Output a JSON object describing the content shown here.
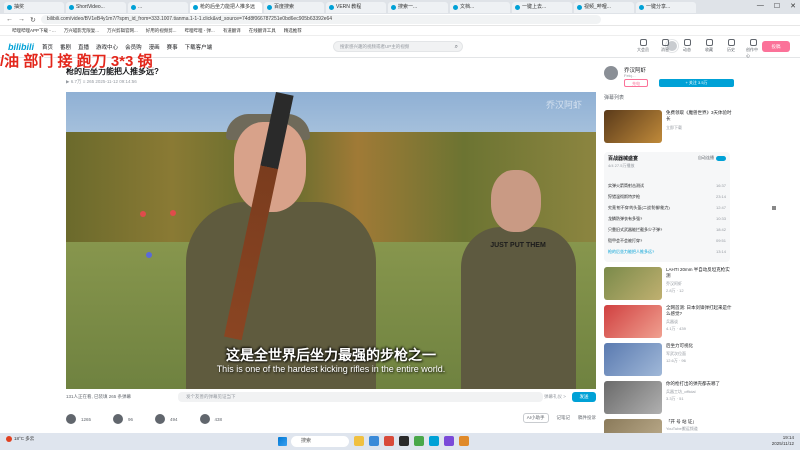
{
  "browser": {
    "tabs": [
      {
        "label": "抽奖",
        "active": false
      },
      {
        "label": "ShortVideo...",
        "active": false
      },
      {
        "label": "...",
        "active": false
      },
      {
        "label": "枪的后坐力能把人推多远",
        "active": true
      },
      {
        "label": "百度搜索",
        "active": false
      },
      {
        "label": "VERN 教程",
        "active": false
      },
      {
        "label": "搜索一...",
        "active": false
      },
      {
        "label": "文档...",
        "active": false
      },
      {
        "label": "一键上去...",
        "active": false
      },
      {
        "label": "视频_哔哩...",
        "active": false
      },
      {
        "label": "一键分享...",
        "active": false
      }
    ],
    "url": "bilibili.com/video/BV1eB4y1m7/?spm_id_from=333.1007.tianma.1-1-1.click&vd_source=74d8f066787251e0bd6ec905b63392e64",
    "bookmarks": [
      "哔哩哔哩APP下载 - ...",
      "万兴喵影无限复...",
      "万兴剪辑官网...",
      "好用的视频剪...",
      "哔哩哔哩 - 弹...",
      "有道翻译",
      "在线翻译工具",
      "精选推荐"
    ]
  },
  "site_header": {
    "logo": "bilibili",
    "nav": [
      "首页",
      "番剧",
      "直播",
      "游戏中心",
      "会员购",
      "漫画",
      "赛事",
      "下载客户端"
    ],
    "search_placeholder": "搜索感兴趣的视频或者UP主的视频",
    "right_icons": [
      {
        "label": "大会员",
        "icon": "vip-icon"
      },
      {
        "label": "消息",
        "icon": "message-icon"
      },
      {
        "label": "动态",
        "icon": "dynamic-icon"
      },
      {
        "label": "收藏",
        "icon": "favorite-icon"
      },
      {
        "label": "历史",
        "icon": "history-icon"
      },
      {
        "label": "创作中心",
        "icon": "creator-icon"
      }
    ],
    "upload_label": "投稿"
  },
  "overlay_text": "/油 部门 接 跑刀 3*3 锅",
  "video": {
    "title": "枪的后坐力能把人推多远?",
    "meta": "▶ 6.7万  ≡ 265  2025-11-12 09:14:56",
    "watermark": "乔汉阿虾",
    "shirt_text": "JUST PUT THEM",
    "subtitle_zh": "这是全世界后坐力最强的步枪之一",
    "subtitle_en": "This is one of the hardest kicking rifles in the entire world."
  },
  "danmu": {
    "count": "131人正在看, 已装填 265 条弹幕",
    "placeholder": "发个友善的弹幕见证当下",
    "etiquette": "弹幕礼仪 >",
    "send_label": "发送"
  },
  "actions": {
    "like": "1265",
    "coin": "96",
    "favorite": "494",
    "share": "438",
    "notes": "AI小助手",
    "more": "记笔记",
    "report": "稿件投诉"
  },
  "uploader": {
    "name": "乔汉阿虾",
    "badge": "发消息",
    "desc": "Feiq…",
    "charge_label": "充电",
    "follow_label": "+ 关注 3.5万"
  },
  "sidebar": {
    "tab_label": "弹幕列表",
    "top_rec": {
      "title": "免费领取《魔兽世界》3天体验时长",
      "meta": "立即下载"
    },
    "list": {
      "title": "百战器械盛宴",
      "sub": "4/4 27.5万播放",
      "auto_label": "自动连播",
      "items": [
        {
          "title": "实弹火箭筒射击测试",
          "dur": "16:37"
        },
        {
          "title": "狩猎温彻斯特步枪",
          "dur": "23:14"
        },
        {
          "title": "究竟'射不穿'的头盔(二战'防御'能力)",
          "dur": "12:47"
        },
        {
          "title": "龙鳞防弹衣有多强?",
          "dur": "10:33"
        },
        {
          "title": "只靠旧式武器能拦截多少子弹?",
          "dur": "18:42"
        },
        {
          "title": "铠甲会不会被打穿?",
          "dur": "09:51"
        },
        {
          "title": "枪的后坐力能把人推多远?",
          "dur": "13:14"
        }
      ]
    },
    "recs": [
      {
        "title": "LAHTI 20mm 半自动反坦克枪实测",
        "up": "乔汉阿虾",
        "stats": "2.8万 · 12"
      },
      {
        "title": "全网首测: 日本剑锋弹打起来是什么感觉?",
        "up": "兵器谈",
        "stats": "4.1万 · 439"
      },
      {
        "title": "后坐力可视化",
        "up": "军武次位面",
        "stats": "12.6万 · 96"
      },
      {
        "title": "你的枪打出的弹壳都去哪了",
        "up": "兵器工坊_official",
        "stats": "3.3万 · 51"
      },
      {
        "title": "「开 号 站 证」",
        "up": "YouTube搬运频道",
        "stats": ""
      }
    ]
  },
  "taskbar": {
    "weather": "18°C 多云",
    "search_label": "搜索",
    "time": "19:14",
    "date": "2025/11/12"
  }
}
